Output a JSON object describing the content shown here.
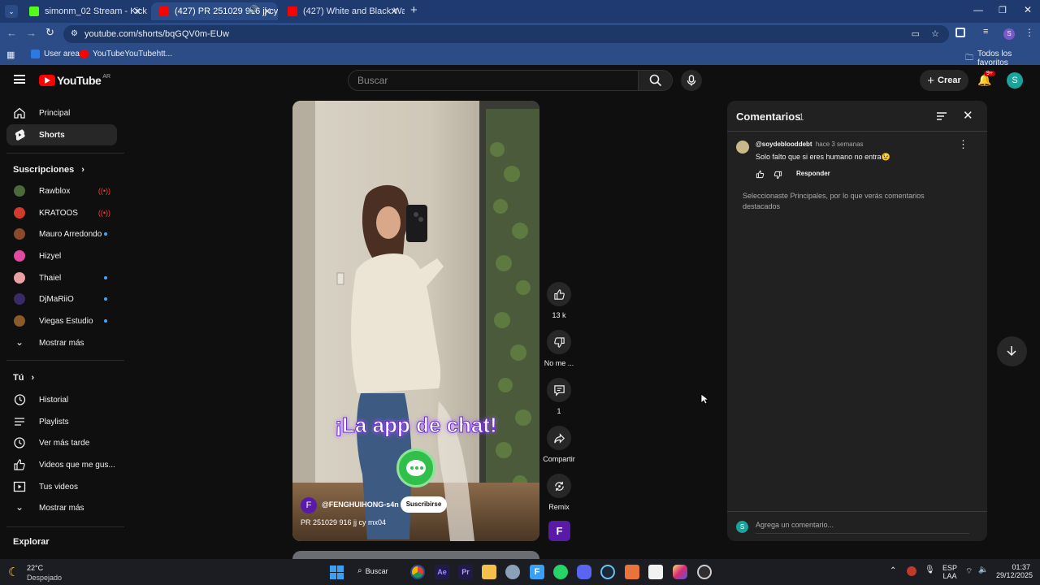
{
  "browser": {
    "tabs": [
      {
        "title": "simonm_02 Stream - Kick Dashb",
        "favicon_color": "#53fc18"
      },
      {
        "title": "(427) PR 251029 916 jj cy m",
        "favicon_color": "#ff0000"
      },
      {
        "title": "(427) White and Black Wallpap",
        "favicon_color": "#ff0000"
      }
    ],
    "url": "youtube.com/shorts/bqGQV0m-EUw",
    "bookmarks": [
      "User area",
      "YouTubeYouTubehtt..."
    ],
    "all_bookmarks": "Todos los favoritos",
    "profile_initial": "S"
  },
  "yt": {
    "logo": "YouTube",
    "region": "AR",
    "search_placeholder": "Buscar",
    "create_label": "Crear",
    "notif_badge": "9+",
    "avatar_initial": "S"
  },
  "sidebar": {
    "main": [
      {
        "label": "Principal",
        "icon": "home-icon"
      },
      {
        "label": "Shorts",
        "icon": "shorts-icon"
      }
    ],
    "subscriptions_title": "Suscripciones",
    "subscriptions": [
      {
        "label": "Rawblox",
        "status": "live",
        "avatar_color": "#4a6a3a"
      },
      {
        "label": "KRATOOS",
        "status": "live",
        "avatar_color": "#d23a2a"
      },
      {
        "label": "Mauro Arredondo",
        "status": "new",
        "avatar_color": "#8a4a2a"
      },
      {
        "label": "Hizyel",
        "status": "",
        "avatar_color": "#e04aa0"
      },
      {
        "label": "Thaiel",
        "status": "new",
        "avatar_color": "#e8a0a0"
      },
      {
        "label": "DjMaRiiO",
        "status": "new",
        "avatar_color": "#3a2a6a"
      },
      {
        "label": "Viegas Estudio",
        "status": "new",
        "avatar_color": "#8a5a2a"
      }
    ],
    "show_more": "Mostrar más",
    "you_title": "Tú",
    "you_items": [
      {
        "label": "Historial",
        "icon": "history-icon"
      },
      {
        "label": "Playlists",
        "icon": "playlists-icon"
      },
      {
        "label": "Ver más tarde",
        "icon": "clock-icon"
      },
      {
        "label": "Videos que me gus...",
        "icon": "thumbs-up-icon"
      },
      {
        "label": "Tus videos",
        "icon": "video-icon"
      }
    ],
    "you_show_more": "Mostrar más",
    "explore_title": "Explorar"
  },
  "short": {
    "overlay_text": "¡La app de chat!",
    "channel": "@FENGHUIHONG-s4n",
    "channel_initial": "F",
    "subscribe_label": "Suscribirse",
    "title": "PR 251029 916 jj cy mx04"
  },
  "actions": {
    "likes": "13 k",
    "dislike": "No me ...",
    "comments": "1",
    "share": "Compartir",
    "remix": "Remix",
    "channel_initial": "F"
  },
  "comments": {
    "title": "Comentarios",
    "count": "1",
    "items": [
      {
        "author": "@soydeblooddebt",
        "time": "hace 3 semanas",
        "text": "Solo falto que si eres humano no entra😉",
        "reply": "Responder"
      }
    ],
    "notice": "Seleccionaste Principales, por lo que verás comentarios destacados",
    "add_placeholder": "Agrega un comentario...",
    "user_initial": "S"
  },
  "taskbar": {
    "weather_temp": "22°C",
    "weather_desc": "Despejado",
    "search_label": "Buscar",
    "lang": "ESP",
    "lang_sub": "LAA",
    "time": "01:37",
    "date": "29/12/2025"
  }
}
